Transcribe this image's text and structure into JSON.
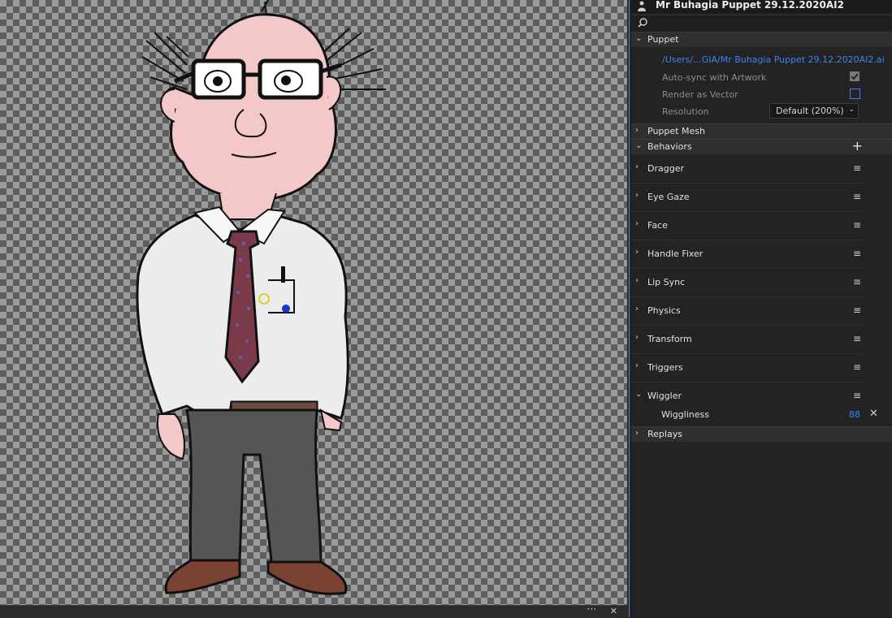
{
  "puppet_title": "Mr Buhagia Puppet 29.12.2020AI2",
  "search": {
    "placeholder": ""
  },
  "sections": {
    "puppet": "Puppet",
    "puppet_mesh": "Puppet Mesh",
    "behaviors": "Behaviors",
    "replays": "Replays"
  },
  "puppet_props": {
    "path": "/Users/...GIA/Mr Buhagia Puppet 29.12.2020AI2.ai",
    "auto_sync_label": "Auto-sync with Artwork",
    "auto_sync_checked": true,
    "render_vector_label": "Render as Vector",
    "render_vector_checked": false,
    "resolution_label": "Resolution",
    "resolution_value": "Default (200%)"
  },
  "behaviors": [
    {
      "label": "Dragger",
      "expanded": false
    },
    {
      "label": "Eye Gaze",
      "expanded": false
    },
    {
      "label": "Face",
      "expanded": false
    },
    {
      "label": "Handle Fixer",
      "expanded": false
    },
    {
      "label": "Lip Sync",
      "expanded": false
    },
    {
      "label": "Physics",
      "expanded": false
    },
    {
      "label": "Transform",
      "expanded": false
    },
    {
      "label": "Triggers",
      "expanded": false
    },
    {
      "label": "Wiggler",
      "expanded": true
    }
  ],
  "wiggler": {
    "param_label": "Wiggliness",
    "param_value": "88"
  },
  "icons": {
    "chevron_right": "›",
    "chevron_down": "⌄",
    "menu": "≡",
    "plus": "+",
    "close": "✕",
    "more": "···"
  },
  "colors": {
    "accent": "#3a86f0",
    "skin": "#f4c8c8",
    "shirt": "#ededed",
    "pants": "#555555",
    "tie": "#7a3a4a"
  }
}
